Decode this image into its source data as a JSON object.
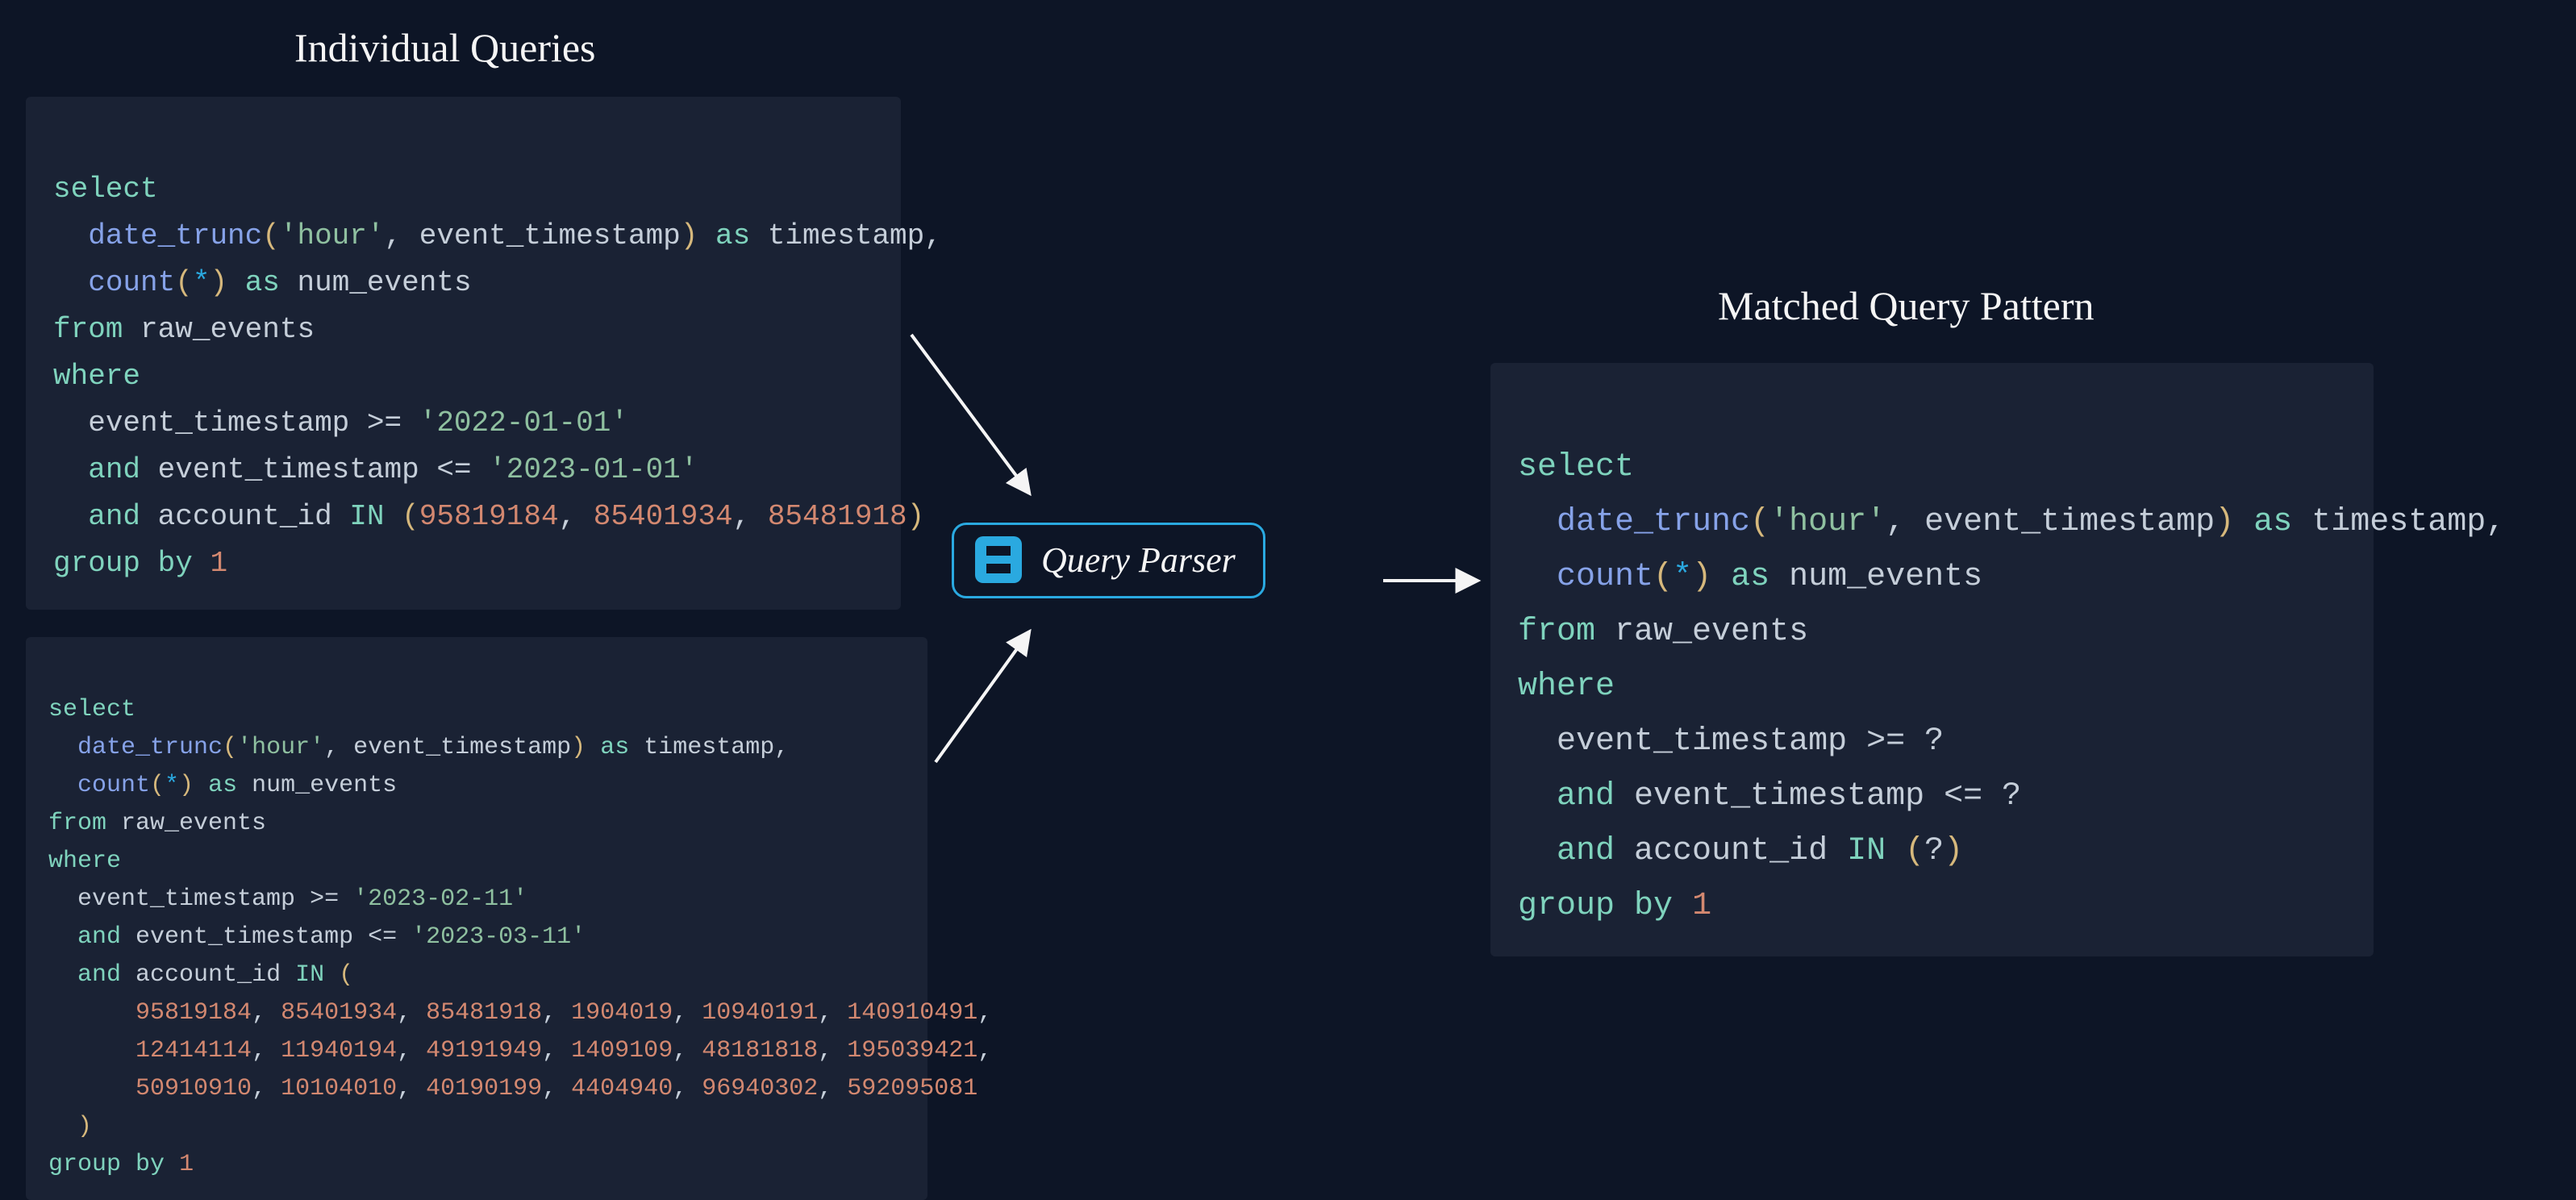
{
  "headings": {
    "left": "Individual Queries",
    "right": "Matched Query Pattern"
  },
  "parser": {
    "label": "Query Parser"
  },
  "query1": {
    "function": "date_trunc",
    "interval": "'hour'",
    "ts_col": "event_timestamp",
    "alias_ts": "timestamp",
    "count_fn": "count",
    "star": "*",
    "alias_n": "num_events",
    "table": "raw_events",
    "start": "'2022-01-01'",
    "end": "'2023-01-01'",
    "acct_col": "account_id",
    "ids": [
      "95819184",
      "85401934",
      "85481918"
    ],
    "groupby": "1"
  },
  "query2": {
    "function": "date_trunc",
    "interval": "'hour'",
    "ts_col": "event_timestamp",
    "alias_ts": "timestamp",
    "count_fn": "count",
    "star": "*",
    "alias_n": "num_events",
    "table": "raw_events",
    "start": "'2023-02-11'",
    "end": "'2023-03-11'",
    "acct_col": "account_id",
    "ids_row1": [
      "95819184",
      "85401934",
      "85481918",
      "1904019",
      "10940191",
      "140910491"
    ],
    "ids_row2": [
      "12414114",
      "11940194",
      "49191949",
      "1409109",
      "48181818",
      "195039421"
    ],
    "ids_row3": [
      "50910910",
      "10104010",
      "40190199",
      "4404940",
      "96940302",
      "592095081"
    ],
    "groupby": "1"
  },
  "pattern": {
    "function": "date_trunc",
    "interval": "'hour'",
    "ts_col": "event_timestamp",
    "alias_ts": "timestamp",
    "count_fn": "count",
    "star": "*",
    "alias_n": "num_events",
    "table": "raw_events",
    "param": "?",
    "acct_col": "account_id",
    "groupby": "1"
  },
  "kw": {
    "select": "select",
    "as": "as",
    "from": "from",
    "where": "where",
    "and": "and",
    "in": "IN",
    "group": "group",
    "by": "by"
  },
  "ops": {
    "ge": ">=",
    "le": "<="
  }
}
